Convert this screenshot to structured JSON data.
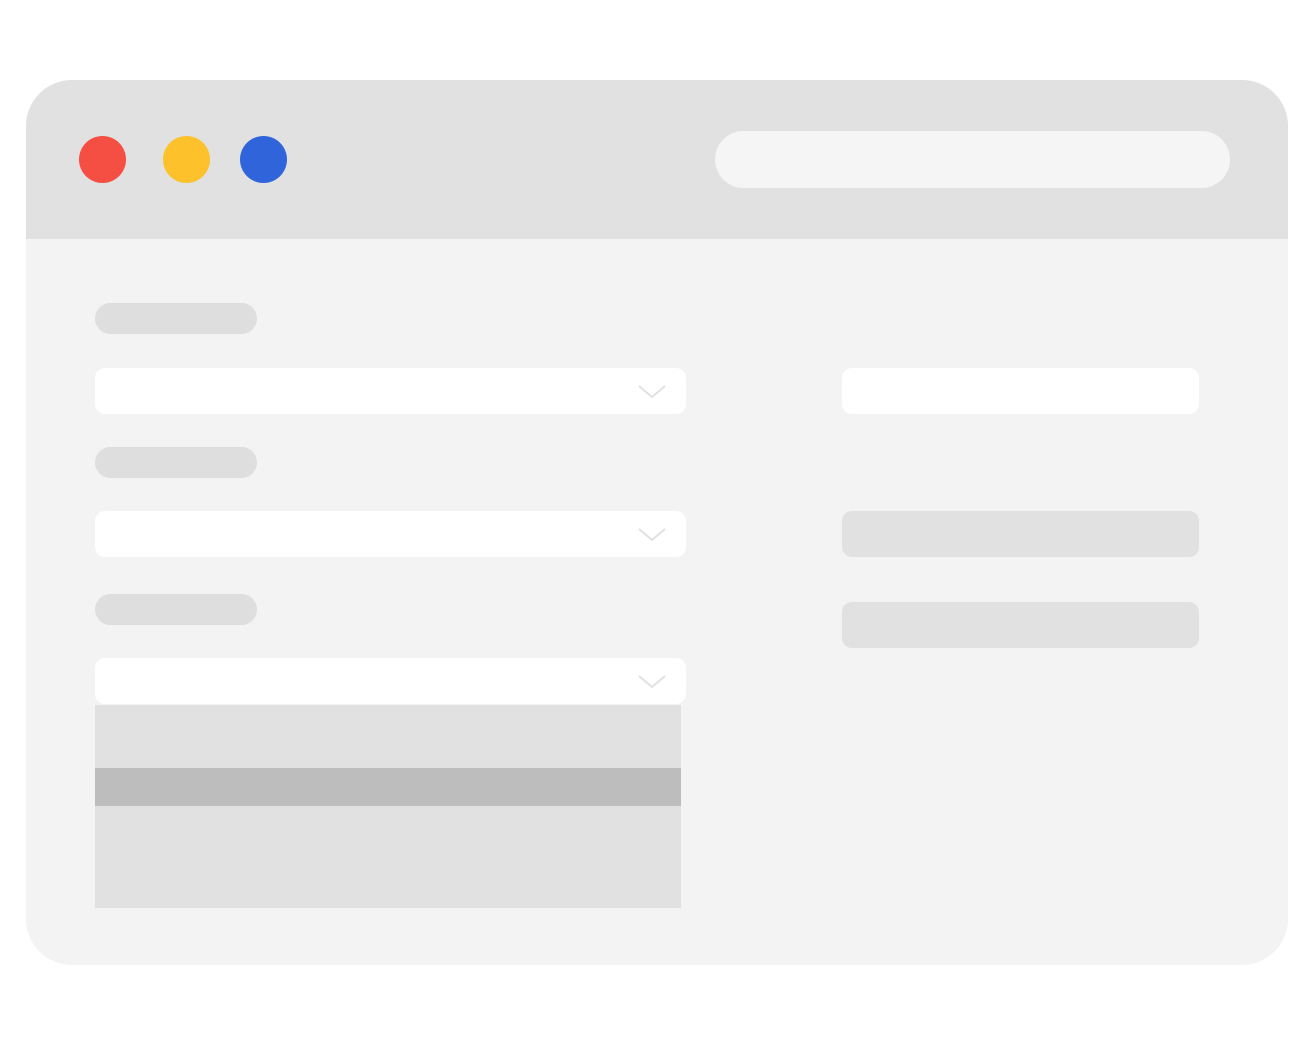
{
  "colors": {
    "close_dot": "#f44f42",
    "minimize_dot": "#fcc12b",
    "zoom_dot": "#3064da",
    "titlebar": "#e1e1e1",
    "window_body": "#f3f3f3",
    "skeleton": "#dedede",
    "dropdown": "#e1e1e1",
    "dropdown_highlight": "#bdbdbd",
    "input": "#ffffff"
  },
  "icons": {
    "window_controls": [
      "close-dot-icon",
      "minimize-dot-icon",
      "zoom-dot-icon"
    ],
    "select_indicator": "chevron-down-icon"
  },
  "form": {
    "fields": [
      {
        "label": "",
        "value": "",
        "expanded": false
      },
      {
        "label": "",
        "value": "",
        "expanded": false
      },
      {
        "label": "",
        "value": "",
        "expanded": true
      }
    ],
    "dropdown": {
      "options": [
        "",
        "",
        ""
      ],
      "highlighted_index": 1
    }
  },
  "address_bar": {
    "value": ""
  }
}
